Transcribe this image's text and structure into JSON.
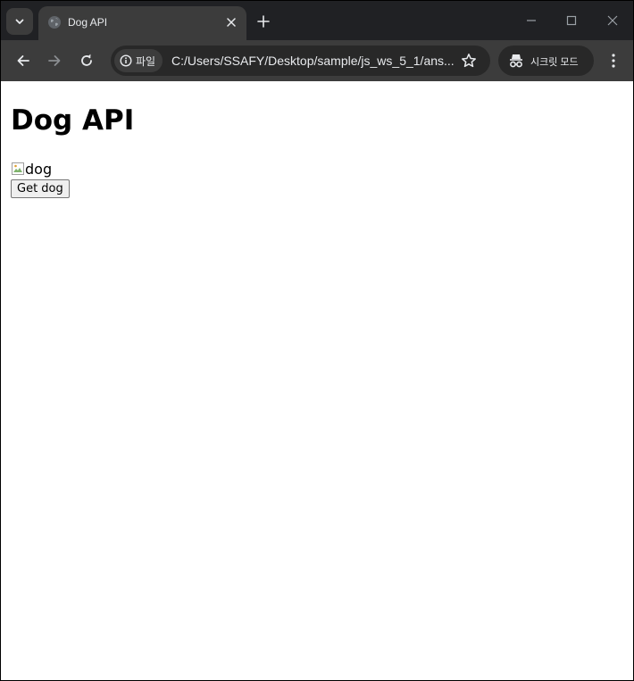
{
  "browser": {
    "tab": {
      "title": "Dog API",
      "favicon": "globe-icon"
    },
    "toolbar": {
      "site_info_label": "파일",
      "url": "C:/Users/SSAFY/Desktop/sample/js_ws_5_1/ans...",
      "incognito_label": "시크릿 모드"
    },
    "colors": {
      "tabstrip_bg": "#202124",
      "toolbar_bg": "#3c3c3c",
      "omnibox_bg": "#282828",
      "text": "#e8eaed"
    }
  },
  "page": {
    "heading": "Dog API",
    "image_alt": "dog",
    "button_label": "Get dog"
  }
}
